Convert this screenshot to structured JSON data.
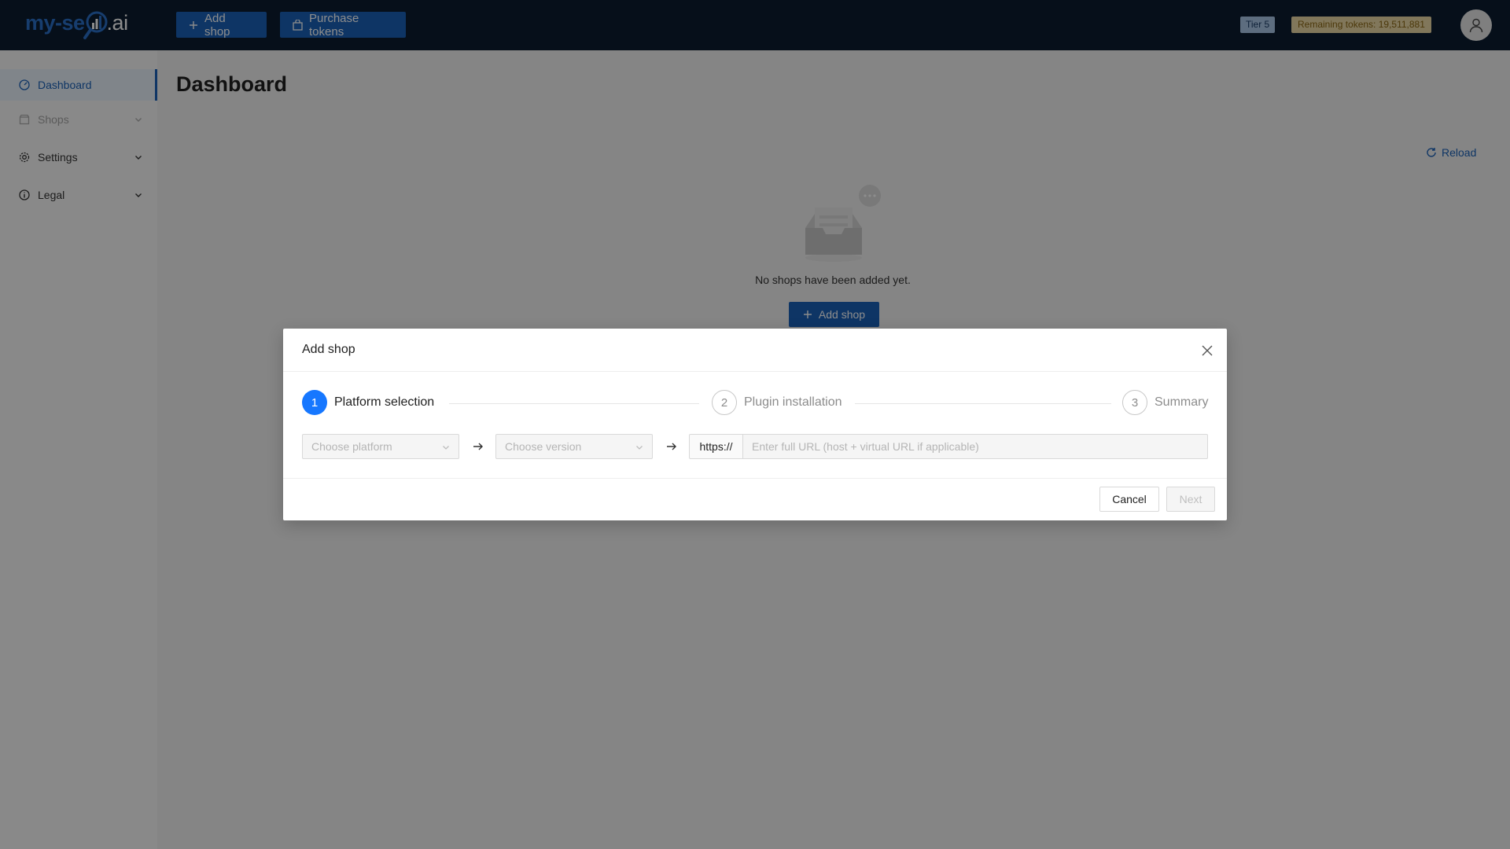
{
  "brand": {
    "logo_main": "my-se",
    "logo_suffix": ".ai"
  },
  "topbar": {
    "add_shop_label": "Add shop",
    "purchase_tokens_label": "Purchase tokens",
    "tier_badge": "Tier 5",
    "tokens_badge": "Remaining tokens: 19,511,881"
  },
  "sidebar": {
    "items": [
      {
        "label": "Dashboard",
        "icon": "dashboard-icon",
        "active": true
      },
      {
        "label": "Shops",
        "icon": "shop-icon",
        "disabled": true
      },
      {
        "label": "Settings",
        "icon": "gear-icon"
      },
      {
        "label": "Legal",
        "icon": "info-icon"
      }
    ]
  },
  "main": {
    "title": "Dashboard",
    "reload_label": "Reload",
    "empty_text": "No shops have been added yet.",
    "add_shop_label": "Add shop"
  },
  "modal": {
    "title": "Add shop",
    "steps": [
      {
        "number": "1",
        "label": "Platform selection",
        "status": "active"
      },
      {
        "number": "2",
        "label": "Plugin installation",
        "status": "wait"
      },
      {
        "number": "3",
        "label": "Summary",
        "status": "wait"
      }
    ],
    "platform_placeholder": "Choose platform",
    "version_placeholder": "Choose version",
    "url_prefix": "https://",
    "url_placeholder": "Enter full URL (host + virtual URL if applicable)",
    "cancel_label": "Cancel",
    "next_label": "Next"
  },
  "colors": {
    "primary": "#1b62b8",
    "header_bg": "#0b1d30",
    "step_active": "#1677ff",
    "tier_badge_bg": "#a9c7e8",
    "tokens_badge_bg": "#ecd9a7"
  }
}
